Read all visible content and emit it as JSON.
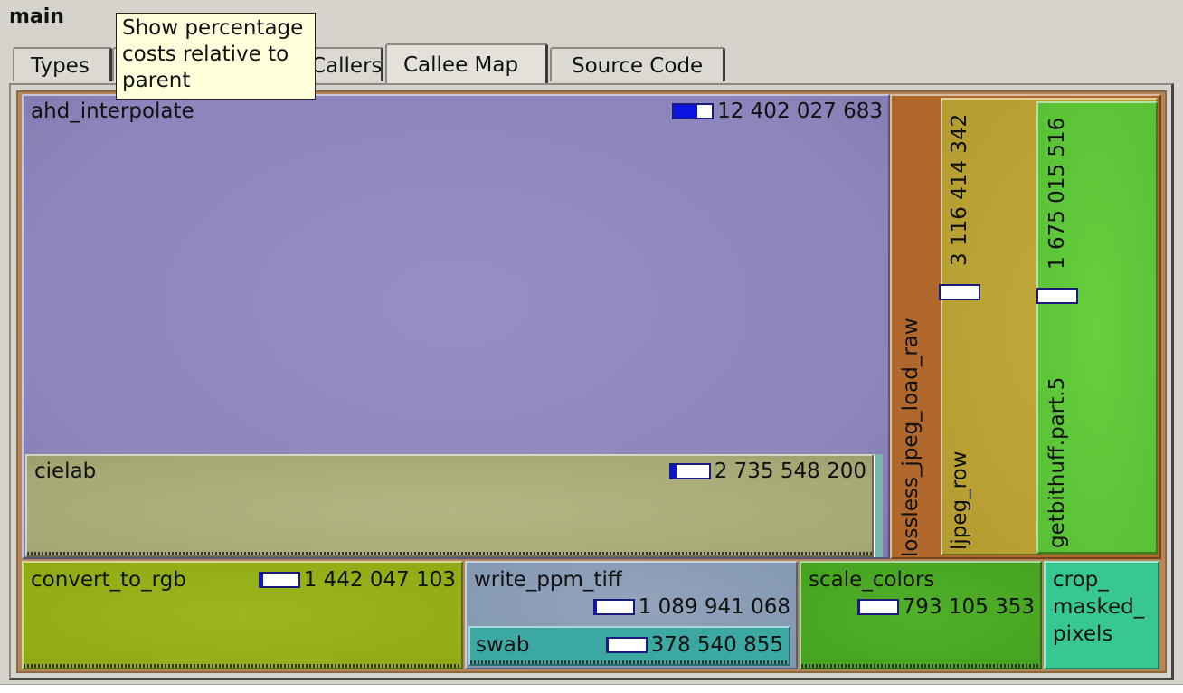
{
  "header": {
    "title": "main"
  },
  "tabs": [
    {
      "label": "Types",
      "active": false
    },
    {
      "label": "Callers",
      "active": false
    },
    {
      "label": "Callee Map",
      "active": true
    },
    {
      "label": "Source Code",
      "active": false
    }
  ],
  "tooltip": {
    "text": "Show percentage costs relative to parent"
  },
  "callee_map": {
    "ahd_interpolate": {
      "name": "ahd_interpolate",
      "cost": "12 402 027 683",
      "fraction": 0.62
    },
    "cielab": {
      "name": "cielab",
      "cost": "2 735 548 200",
      "fraction": 0.14
    },
    "lossless_jpeg_load_raw": {
      "name": "lossless_jpeg_load_raw"
    },
    "ljpeg_row": {
      "name": "ljpeg_row",
      "cost": "3 116 414 342",
      "fraction": 0.16
    },
    "getbithuff": {
      "name": "getbithuff.part.5",
      "cost": "1 675 015 516",
      "fraction": 0.08
    },
    "convert_to_rgb": {
      "name": "convert_to_rgb",
      "cost": "1 442 047 103",
      "fraction": 0.07
    },
    "write_ppm_tiff": {
      "name": "write_ppm_tiff",
      "cost": "1 089 941 068",
      "fraction": 0.05
    },
    "swab": {
      "name": "swab",
      "cost": "378 540 855",
      "fraction": 0.02
    },
    "scale_colors": {
      "name": "scale_colors",
      "cost": "793 105 353",
      "fraction": 0.04
    },
    "crop_masked_pixels": {
      "line1": "crop_",
      "line2": "masked_",
      "line3": "pixels"
    }
  },
  "colors": {
    "ahd": "#8c86ba",
    "cielab": "#a8aa7a",
    "lossless": "#b0682c",
    "ljpeg": "#b8a034",
    "getbithuff": "#5ec63a",
    "convert": "#94ae18",
    "write": "#889ab2",
    "swab": "#3aa6a0",
    "scale": "#4aaa24",
    "crop": "#34c88e"
  }
}
